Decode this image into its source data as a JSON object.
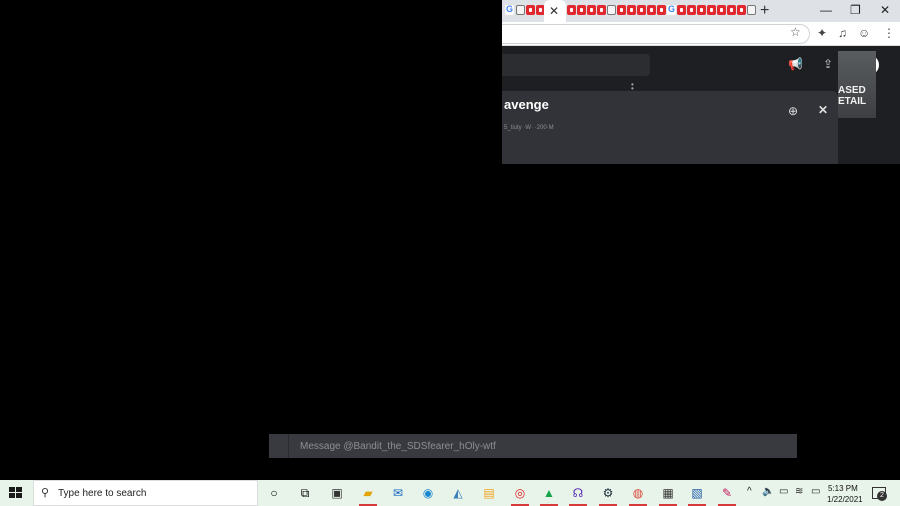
{
  "browser": {
    "tabs": [
      {
        "icon": "gmail-g-icon"
      },
      {
        "icon": "pinned-tab-icon"
      },
      {
        "icon": "youtube-icon"
      },
      {
        "icon": "discord-icon"
      }
    ],
    "active_tab_close": "✕",
    "new_tab": "+",
    "window_controls": {
      "minimize": "—",
      "restore": "❐",
      "close": "✕"
    },
    "toolbar": {
      "star": "☆",
      "extensions": "✦",
      "media": "♫",
      "profile": "☺",
      "menu": "⋮"
    }
  },
  "discord": {
    "popup_title": "avenge",
    "popup_subtitle": "5_tiuty ·W· ·200·M",
    "popup_add_icon": "⊕",
    "popup_close": "✕",
    "thumbnail_text": "ASED\nETAIL",
    "message_placeholder": "Message @Bandit_the_SDSfearer_hOly-wtf"
  },
  "taskbar": {
    "search_placeholder": "Type here to search",
    "clock_time": "5:13 PM",
    "clock_date": "1/22/2021",
    "notification_count": "2"
  }
}
